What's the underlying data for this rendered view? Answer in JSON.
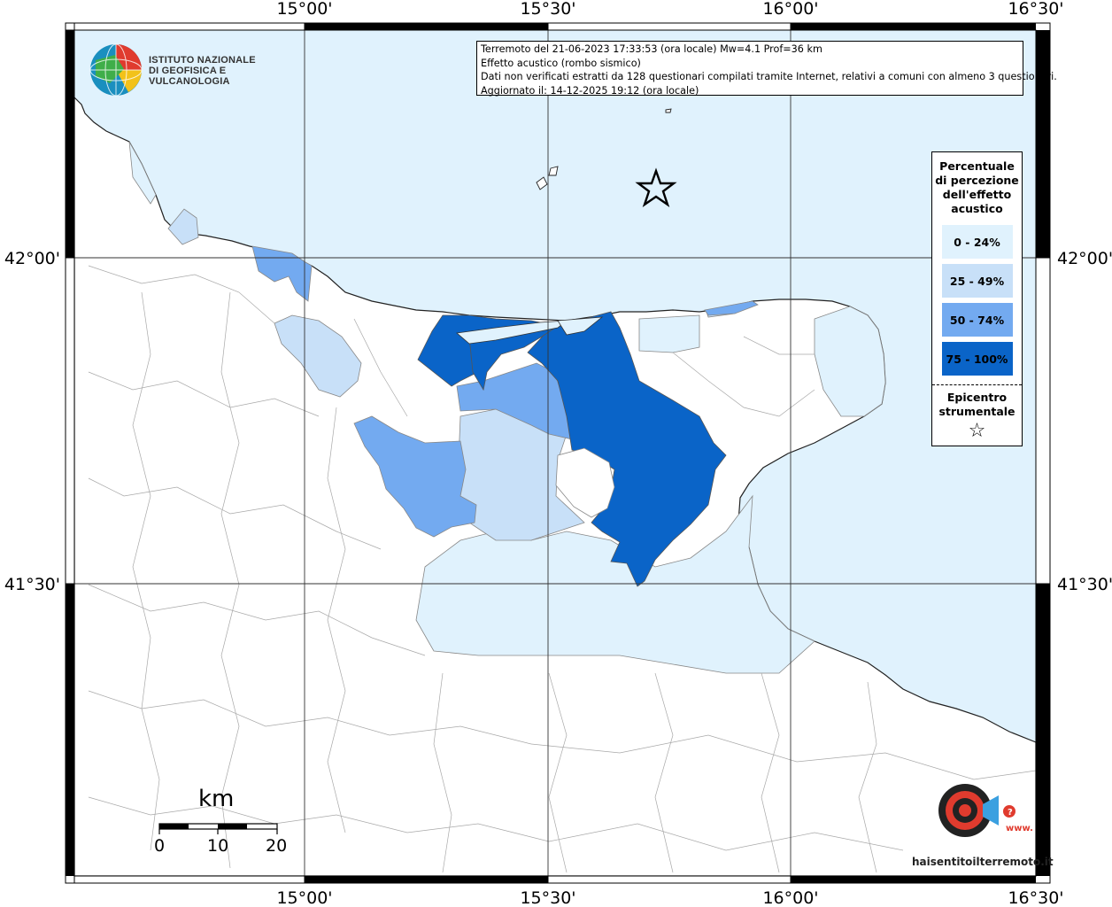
{
  "map": {
    "info": {
      "line1": "Terremoto del 21-06-2023 17:33:53 (ora locale) Mw=4.1 Prof=36 km",
      "line2": "Effetto acustico (rombo sismico)",
      "line3": "Dati non verificati estratti da 128 questionari compilati tramite Internet, relativi a comuni con almeno 3 questionari.",
      "line4": "Aggiornato il: 14-12-2025 19:12 (ora locale)"
    },
    "logo": {
      "line1": "ISTITUTO NAZIONALE",
      "line2": "DI GEOFISICA E VULCANOLOGIA"
    },
    "lon_ticks": [
      "15°00'",
      "15°30'",
      "16°00'",
      "16°30'"
    ],
    "lat_ticks": [
      "42°00'",
      "41°30'"
    ],
    "legend": {
      "title": "Percentuale di percezione dell'effetto acustico",
      "classes": [
        {
          "label": "0 - 24%",
          "color": "#e0f2fd"
        },
        {
          "label": "25 - 49%",
          "color": "#c8e0f8"
        },
        {
          "label": "50 - 74%",
          "color": "#73aaf0"
        },
        {
          "label": "75 - 100%",
          "color": "#0a64c8"
        }
      ],
      "epicenter_label": "Epicentro strumentale",
      "epicenter_symbol": "☆"
    },
    "scale": {
      "unit": "km",
      "labels": [
        "0",
        "10",
        "20"
      ]
    },
    "badge": {
      "text": "haisentitoilterremoto.it",
      "url_text": "www."
    },
    "colors": {
      "sea": "#e0f2fd",
      "land": "#ffffff",
      "boundary": "#999999",
      "coast": "#222222"
    }
  }
}
